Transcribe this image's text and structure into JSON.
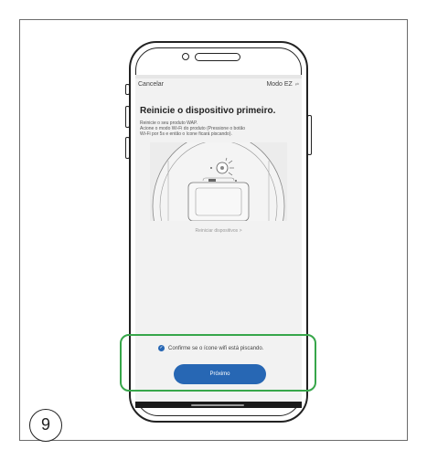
{
  "nav": {
    "cancel_label": "Cancelar",
    "mode_label": "Modo EZ",
    "mode_icon": "swap-icon"
  },
  "content": {
    "title": "Reinicie o dispositivo primeiro.",
    "description_lines": [
      "Reinicie o seu produto WAP.",
      "Acione o modo Wi-Fi do produto (Pressione o botão",
      "Wi-Fi por 5s e então o ícone ficará piscando)."
    ],
    "reset_link": "Reiniciar dispositivos >"
  },
  "footer": {
    "confirm_text": "Confirme se o ícone wifi está piscando.",
    "next_button": "Próximo"
  },
  "step_number": "9",
  "colors": {
    "accent": "#2767b4",
    "highlight": "#37a64a"
  }
}
